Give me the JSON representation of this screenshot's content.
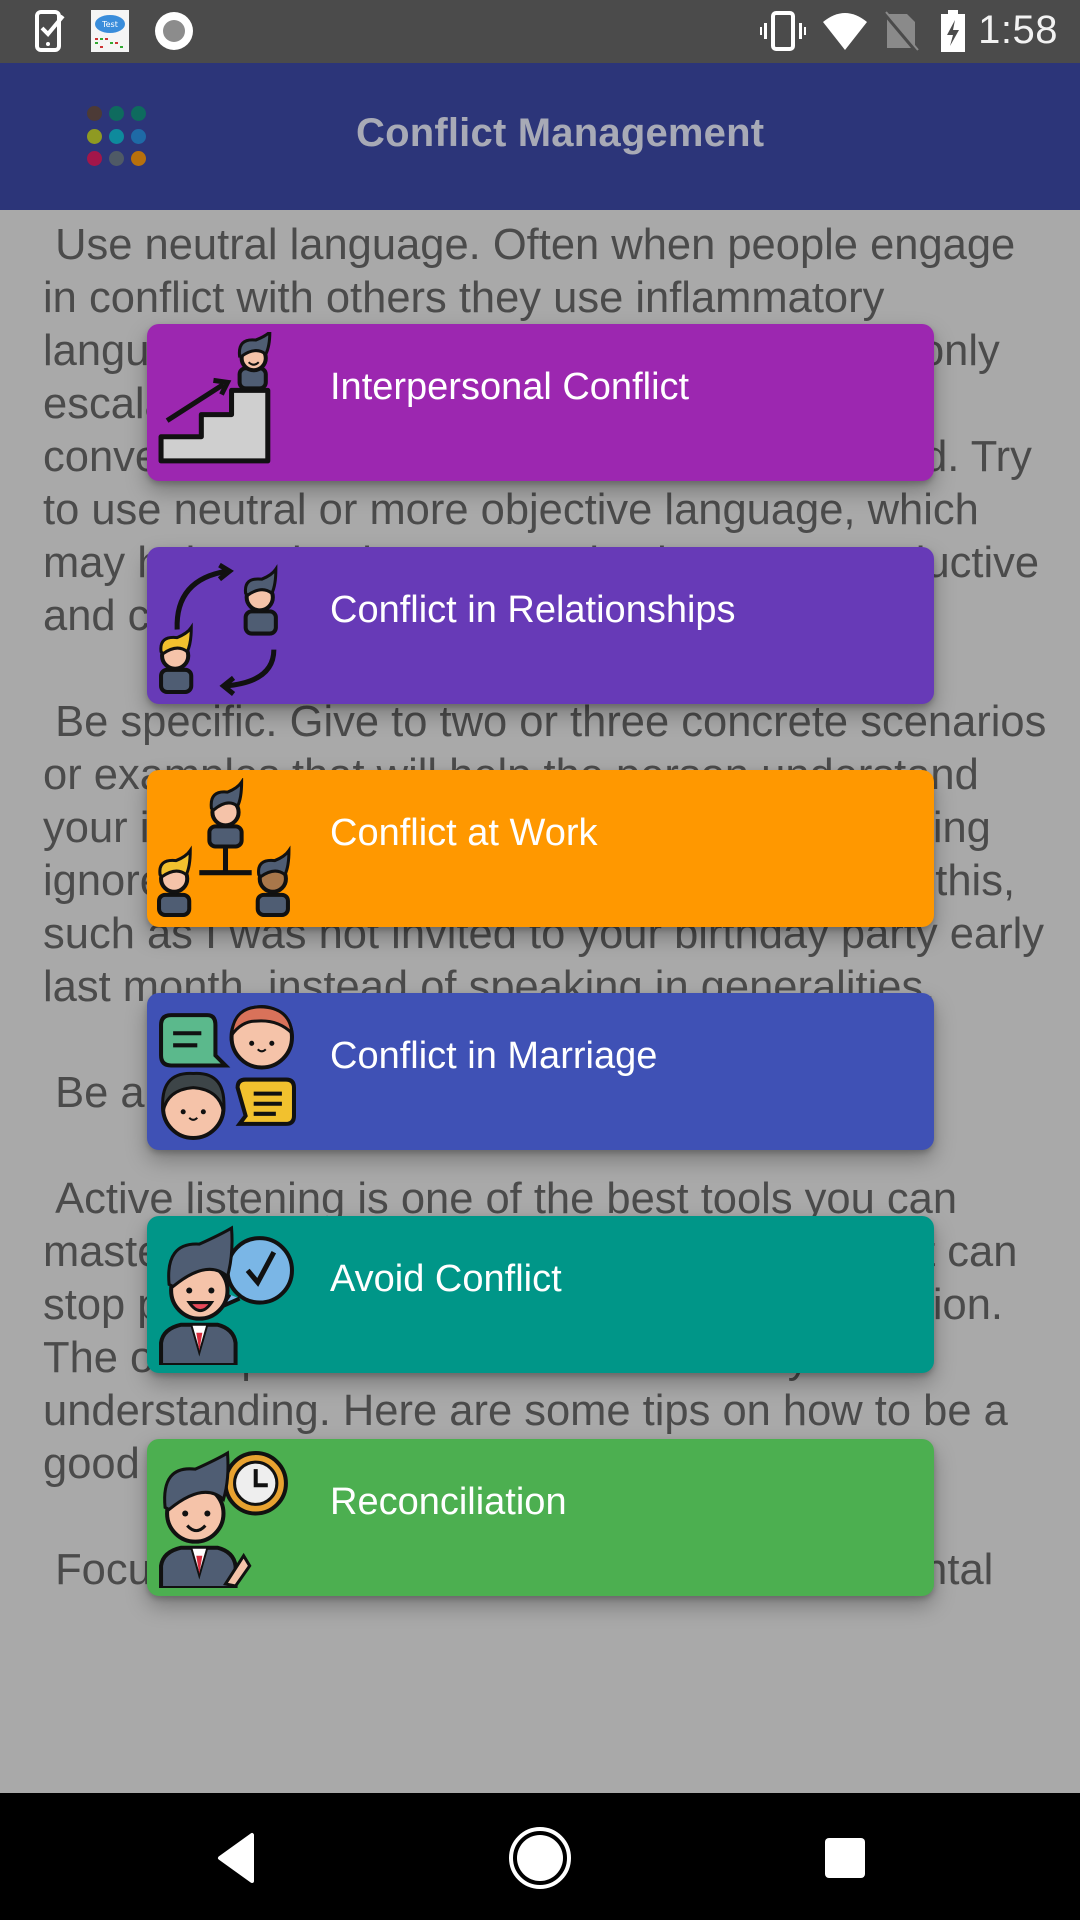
{
  "status_bar": {
    "time": "1:58",
    "left_icons": [
      "task-checklist-icon",
      "test-app-cloud-icon",
      "record-circle-icon"
    ],
    "right_icons": [
      "vibrate-icon",
      "wifi-icon",
      "no-sim-icon",
      "battery-charging-icon"
    ]
  },
  "app_bar": {
    "title": "Conflict Management",
    "logo_dots": [
      "#4c3a36",
      "#0e6b5e",
      "#0e6b5e",
      "#8f9a22",
      "#0e8a9c",
      "#1e6aa6",
      "#a3164a",
      "#4f5a66",
      "#b8700c"
    ]
  },
  "article": {
    "paragraphs": [
      " Use neutral language. Often when people engage in conflict with others they use inflammatory language, name-calling, and put-downs. This only escalates the conflict and often pushes the conversation away from the key issues at hand. Try to use neutral or more objective language, which may help make the communication more productive and calm.",
      " Be specific. Give to two or three concrete scenarios or examples that will help the person understand your issue. For example, if you have been feeling ignored by a friend, give a specific instance of this, such as I was not invited to your birthday party early last month, instead of speaking in generalities.",
      " Be an active listener.",
      " Active listening is one of the best tools you can master. It is appropriate for everyday life and it can stop positive and non-threatening communication. The other person will notice and value your understanding. Here are some tips on how to be a good active listener:",
      " Focus on the other person. Put aside any mental"
    ]
  },
  "menu": {
    "items": [
      {
        "label": "Interpersonal Conflict",
        "color": "#9c27b0",
        "icon": "stairs-climb-icon"
      },
      {
        "label": "Conflict in Relationships",
        "color": "#673ab7",
        "icon": "relationship-cycle-icon"
      },
      {
        "label": "Conflict at Work",
        "color": "#ff9800",
        "icon": "team-hierarchy-icon"
      },
      {
        "label": "Conflict in Marriage",
        "color": "#3f51b5",
        "icon": "couple-chat-icon"
      },
      {
        "label": "Avoid Conflict",
        "color": "#009688",
        "icon": "approved-speech-icon"
      },
      {
        "label": "Reconciliation",
        "color": "#4caf50",
        "icon": "clock-businessman-icon"
      }
    ]
  },
  "nav_bar": {
    "back": "back-icon",
    "home": "home-icon",
    "recents": "recents-icon"
  }
}
